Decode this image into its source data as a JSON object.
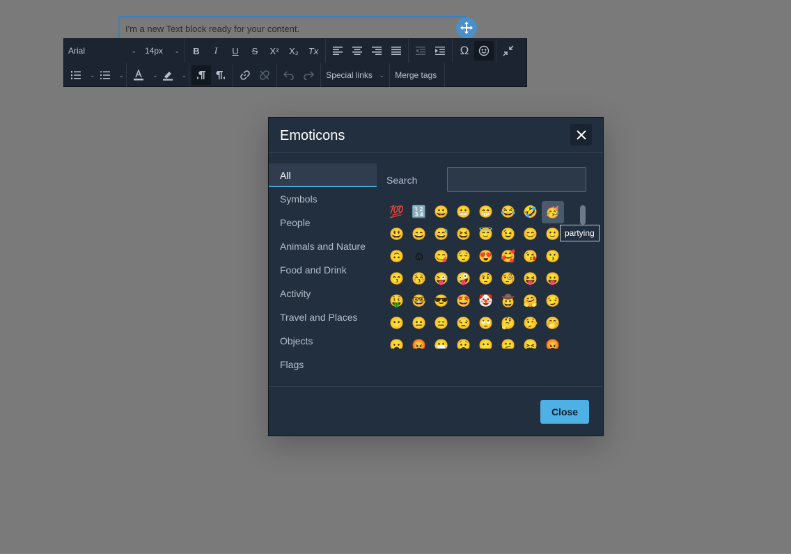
{
  "editor": {
    "text_block": "I'm a new Text block ready for your content."
  },
  "toolbar": {
    "font_family": "Arial",
    "font_size": "14px",
    "special_links": "Special links",
    "merge_tags": "Merge tags",
    "bold": "B",
    "italic": "I",
    "underline": "U",
    "strike": "S",
    "superscript": "X²",
    "subscript": "X₂",
    "clear_format": "Tx",
    "special_char": "Ω"
  },
  "dialog": {
    "title": "Emoticons",
    "search_label": "Search",
    "search_value": "",
    "close_button": "Close",
    "categories": [
      {
        "label": "All",
        "active": true
      },
      {
        "label": "Symbols",
        "active": false
      },
      {
        "label": "People",
        "active": false
      },
      {
        "label": "Animals and Nature",
        "active": false
      },
      {
        "label": "Food and Drink",
        "active": false
      },
      {
        "label": "Activity",
        "active": false
      },
      {
        "label": "Travel and Places",
        "active": false
      },
      {
        "label": "Objects",
        "active": false
      },
      {
        "label": "Flags",
        "active": false
      }
    ],
    "emojis": [
      "💯",
      "🔢",
      "😀",
      "😬",
      "😁",
      "😂",
      "🤣",
      "🥳",
      "😃",
      "😄",
      "😅",
      "😆",
      "😇",
      "😉",
      "😊",
      "🙂",
      "🙃",
      "☺",
      "😋",
      "😌",
      "😍",
      "🥰",
      "😘",
      "😗",
      "😙",
      "😚",
      "😜",
      "🤪",
      "🤨",
      "🧐",
      "😝",
      "😛",
      "🤑",
      "🤓",
      "😎",
      "🤩",
      "🤡",
      "🤠",
      "🤗",
      "😏",
      "😶",
      "😐",
      "😑",
      "😒",
      "🙄",
      "🤔",
      "🤥",
      "🤭",
      "😦",
      "😡",
      "😷",
      "😟",
      "😶",
      "😕",
      "😖",
      "😡"
    ],
    "hovered_index": 7,
    "tooltip": "partying"
  }
}
